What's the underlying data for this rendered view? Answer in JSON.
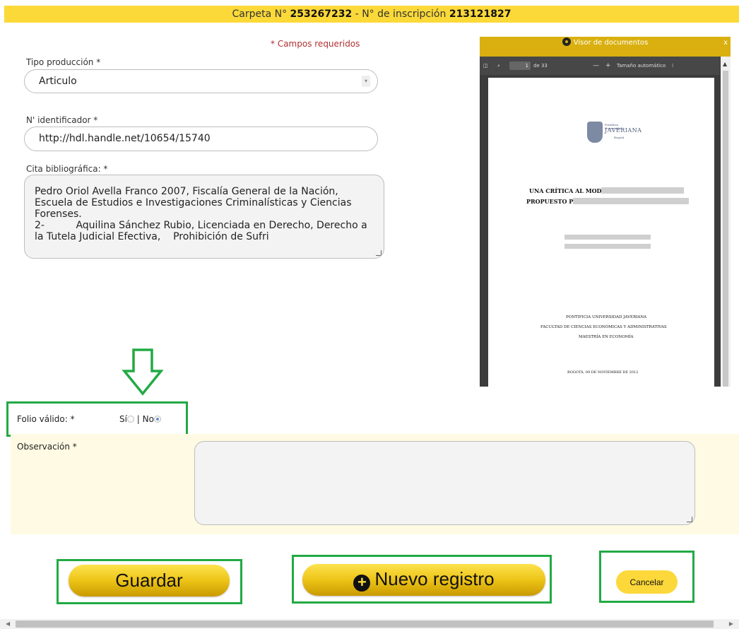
{
  "banner": {
    "carpeta_label": "Carpeta N°",
    "carpeta_number": "253267232",
    "separator": "-",
    "inscripcion_label": "N° de inscripción",
    "inscripcion_number": "213121827"
  },
  "form": {
    "required_note": "* Campos requeridos",
    "tipo_label": "Tipo producción *",
    "tipo_value": "Articulo",
    "identificador_label": "N' identificador *",
    "identificador_value": "http://hdl.handle.net/10654/15740",
    "cita_label": "Cita bibliográfica: *",
    "cita_value": "Pedro Oriol Avella Franco 2007, Fiscalía General de la Nación,\nEscuela de Estudios e Investigaciones Criminalísticas y Ciencias\nForenses.\n2-          Aquilina Sánchez Rubio, Licenciada en Derecho, Derecho a\nla Tutela Judicial Efectiva,    Prohibición de Sufri"
  },
  "viewer": {
    "title": "Visor de documentos",
    "close": "x",
    "page_current": "1",
    "page_total": "de 33",
    "zoom_label": "Tamaño automático",
    "document": {
      "logo_line1": "Pontificia Universidad",
      "logo_line2": "JAVERIANA",
      "logo_line3": "Bogotá",
      "title_line1": "UNA CRÍTICA AL MODELO",
      "title_line2": "PROPUESTO POR",
      "institution_line1": "PONTIFICIA UNIVERSIDAD JAVERIANA",
      "institution_line2": "FACULTAD DE CIENCIAS ECONÓMICAS Y ADMINISTRATIVAS",
      "institution_line3": "MAESTRÍA EN ECONOMÍA",
      "date_line": "BOGOTÁ, 09 DE NOVIEMBRE DE 2012"
    }
  },
  "folio": {
    "label": "Folio válido: *",
    "yes_label": "Sí",
    "separator": "|",
    "no_label": "No",
    "selected": "No"
  },
  "observacion": {
    "label": "Observación *",
    "value": ""
  },
  "buttons": {
    "guardar": "Guardar",
    "nuevo": "Nuevo registro",
    "cancelar": "Cancelar"
  },
  "colors": {
    "banner": "#fbd939",
    "highlight_box": "#22aa44",
    "observation_panel": "#fffae3",
    "viewer_header": "#d9b00f"
  }
}
